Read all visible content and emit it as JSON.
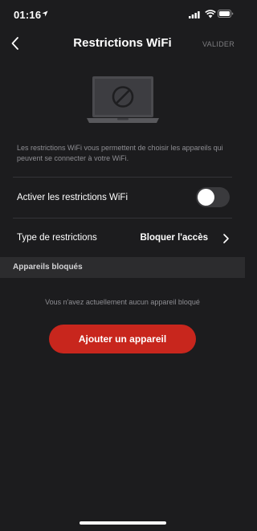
{
  "status_bar": {
    "time": "01:16",
    "icons": [
      "location-arrow-icon",
      "cellular-signal-icon",
      "wifi-icon",
      "battery-icon"
    ]
  },
  "nav": {
    "back_icon": "chevron-left-icon",
    "title": "Restrictions WiFi",
    "action_label": "VALIDER"
  },
  "hero": {
    "icon": "laptop-blocked-icon"
  },
  "description": "Les restrictions WiFi vous permettent de choisir les appareils qui peuvent se connecter à votre WiFi.",
  "settings": {
    "enable_label": "Activer les restrictions WiFi",
    "enable_value": false,
    "type_label": "Type de restrictions",
    "type_value": "Bloquer l'accès"
  },
  "blocked_section": {
    "header": "Appareils bloqués",
    "empty_text": "Vous n'avez actuellement aucun appareil bloqué",
    "add_button_label": "Ajouter un appareil"
  },
  "colors": {
    "background": "#1c1c1e",
    "section_header": "#2c2c2e",
    "accent": "#c8261d",
    "muted_text": "#8e8e93"
  }
}
